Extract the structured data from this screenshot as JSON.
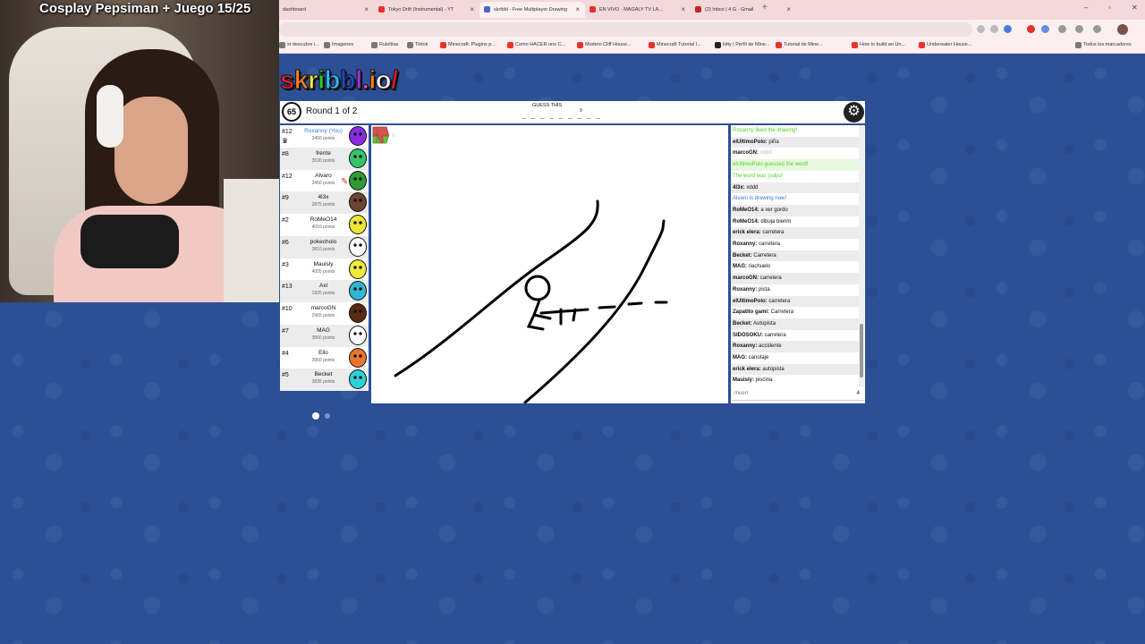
{
  "stream": {
    "title": "Cosplay Pepsiman + Juego 15/25"
  },
  "browser": {
    "tabs": [
      {
        "label": "dashboard",
        "color": "#6c6c6c"
      },
      {
        "label": "Tokyo Drift (Instrumental) - YT",
        "color": "#e8312a"
      },
      {
        "label": "skribbl - Free Multiplayer Drawing",
        "color": "#4b62c9"
      },
      {
        "label": "EN VIVO - MAGALY TV LA...",
        "color": "#e8312a"
      },
      {
        "label": "(2) Inbox | 4 G - Gmail",
        "color": "#c5221f"
      }
    ],
    "new_tab": "+",
    "bookmarks": [
      {
        "label": "st descubre i...",
        "color": "#777777"
      },
      {
        "label": "Imagenes",
        "color": "#777777"
      },
      {
        "label": "Ruletitas",
        "color": "#777777"
      },
      {
        "label": "Tiktok",
        "color": "#777777"
      },
      {
        "label": "Minecraft: Plugins p...",
        "color": "#e8312a"
      },
      {
        "label": "Como HACER uno C...",
        "color": "#e8312a"
      },
      {
        "label": "Modern Cliff House...",
        "color": "#e8312a"
      },
      {
        "label": "Minecraft Tutorial I...",
        "color": "#e8312a"
      },
      {
        "label": "kitty | Perfil de Mine...",
        "color": "#222222"
      },
      {
        "label": "Tutorial de Mine...",
        "color": "#e8312a"
      },
      {
        "label": "How to build an Un...",
        "color": "#e8312a"
      },
      {
        "label": "Underwater House...",
        "color": "#e8312a"
      },
      {
        "label": "Todos los marcadores",
        "color": "#777777"
      }
    ],
    "window_controls": [
      "–",
      "▫",
      "✕"
    ]
  },
  "game": {
    "logo": "skribbl.io/",
    "timer": "65",
    "round_text": "Round 1 of 2",
    "guess_label": "GUESS THIS",
    "word_blanks": "_ _ _ _ _ _ _ _ _",
    "word_length": "9",
    "settings_icon": "⚙",
    "drawer_ghost": "Alvaro is",
    "players": [
      {
        "rank": "#12",
        "name": "Roxanny (You)",
        "points": "2450 points",
        "color": "#8a2be2",
        "you": true,
        "crown": true
      },
      {
        "rank": "#8",
        "name": "frente",
        "points": "3530 points",
        "color": "#35c46e"
      },
      {
        "rank": "#12",
        "name": "Alvaro",
        "points": "2450 points",
        "color": "#2e9d33",
        "drawing": true
      },
      {
        "rank": "#9",
        "name": "4l3x",
        "points": "2875 points",
        "color": "#6b4434"
      },
      {
        "rank": "#2",
        "name": "RoMeO14",
        "points": "4010 points",
        "color": "#efe33a"
      },
      {
        "rank": "#6",
        "name": "pokecholo",
        "points": "3810 points",
        "color": "#ffffff"
      },
      {
        "rank": "#3",
        "name": "Mauisly",
        "points": "4005 points",
        "color": "#f0ea3a"
      },
      {
        "rank": "#13",
        "name": "Axl",
        "points": "1925 points",
        "color": "#2fb7d4"
      },
      {
        "rank": "#10",
        "name": "marcoGN",
        "points": "2965 points",
        "color": "#5a2a16"
      },
      {
        "rank": "#7",
        "name": "MAG",
        "points": "3560 points",
        "color": "#ffffff"
      },
      {
        "rank": "#4",
        "name": "Ello",
        "points": "3950 points",
        "color": "#e8762c"
      },
      {
        "rank": "#5",
        "name": "Becket",
        "points": "3835 points",
        "color": "#2ed1d8"
      }
    ],
    "bubbles": [
      {
        "text": "piscina"
      },
      {
        "text": "canotaje"
      }
    ],
    "chat": [
      {
        "who": "",
        "text": "Roxanny liked the drawing!",
        "style": "liked"
      },
      {
        "who": "elUltimoPolo:",
        "text": " piña",
        "style": ""
      },
      {
        "who": "marcoGN:",
        "text": " xddd",
        "style": "faded"
      },
      {
        "who": "",
        "text": "elUltimoPolo guessed the word!",
        "style": "green"
      },
      {
        "who": "",
        "text": "The word was 'pulpo'",
        "style": "liked"
      },
      {
        "who": "4l3x:",
        "text": " xddd",
        "style": ""
      },
      {
        "who": "",
        "text": "Alvaro is drawing now!",
        "style": "blue"
      },
      {
        "who": "RoMeO14:",
        "text": " a ver gordo",
        "style": ""
      },
      {
        "who": "RoMeO14:",
        "text": " dibuja bienm",
        "style": ""
      },
      {
        "who": "erick elera:",
        "text": " carretera",
        "style": ""
      },
      {
        "who": "Roxanny:",
        "text": " carretera",
        "style": ""
      },
      {
        "who": "Becket:",
        "text": " Carretera",
        "style": ""
      },
      {
        "who": "MAG:",
        "text": " riachuelo",
        "style": ""
      },
      {
        "who": "marcoGN:",
        "text": " carretera",
        "style": ""
      },
      {
        "who": "Roxanny:",
        "text": " pista",
        "style": ""
      },
      {
        "who": "elUltimoPolo:",
        "text": " carretera",
        "style": ""
      },
      {
        "who": "Zapatito gami:",
        "text": " Carretera",
        "style": ""
      },
      {
        "who": "Becket:",
        "text": " Autopista",
        "style": ""
      },
      {
        "who": "SIDOSOKU:",
        "text": " carretera",
        "style": ""
      },
      {
        "who": "Roxanny:",
        "text": " accidente",
        "style": ""
      },
      {
        "who": "MAG:",
        "text": " canotaje",
        "style": ""
      },
      {
        "who": "erick elera:",
        "text": " autopista",
        "style": ""
      },
      {
        "who": "Mauisly:",
        "text": " piscina",
        "style": ""
      }
    ],
    "chat_input": {
      "value": "muerr",
      "count": "4"
    },
    "accent": {
      "like": "#67c23a",
      "dislike": "#d9534f"
    }
  }
}
